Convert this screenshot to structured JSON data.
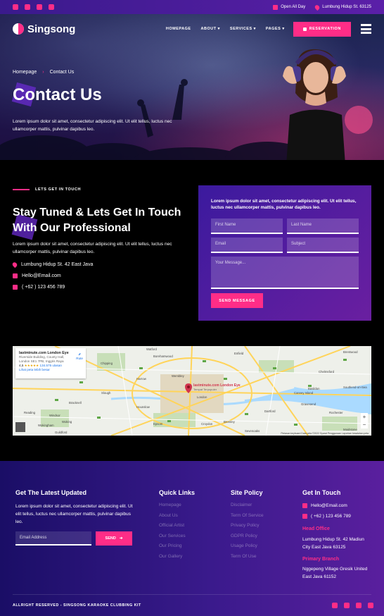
{
  "topbar": {
    "socials": [
      "facebook-icon",
      "twitter-icon",
      "youtube-icon",
      "linkedin-icon"
    ],
    "hours": "Open All Day",
    "address": "Lumbung Hidup St. 63125"
  },
  "nav": {
    "logo": "Singsong",
    "items": [
      "HOMEPAGE",
      "ABOUT",
      "SERVICES",
      "PAGES"
    ],
    "reservation": "RESERVATION"
  },
  "hero": {
    "breadcrumb": [
      "Homepage",
      "Contact Us"
    ],
    "title": "Contact Us",
    "text": "Lorem ipsum dolor sit amet, consectetur adipiscing elit. Ut elit tellus, luctus nec ullamcorper mattis, pulvinar dapibus leo."
  },
  "contact": {
    "eyebrow": "LETS GET IN TOUCH",
    "title": "Stay Tuned & Lets Get In Touch With Our Professional",
    "text": "Lorem ipsum dolor sit amet, consectetur adipiscing elit. Ut elit tellus, luctus nec ullamcorper mattis, pulvinar dapibus leo.",
    "address": "Lumbung Hidup St. 42 East Java",
    "email": "Hello@Email.com",
    "phone": "( +62 ) 123 456 789"
  },
  "form": {
    "intro": "Lorem ipsum dolor sit amet, consectetur adipiscing elit. Ut elit tellus, luctus nec ullamcorper mattis, pulvinar dapibus leo.",
    "first_name": "First Name",
    "last_name": "Last Name",
    "email": "Email",
    "subject": "Subject",
    "message": "Your Message...",
    "send": "SEND MESSAGE"
  },
  "map": {
    "place": "lastminute.com London Eye",
    "place_address": "Riverside Building, County Hall, London SE1 7PB, Inggris Raya",
    "rating": "4,5",
    "stars": "★★★★★",
    "reviews": "134.575 ulasan",
    "larger_map": "Lihat peta lebih besar",
    "route": "Rute",
    "pin_label": "lastminute.com London Eye",
    "pin_sub": "Tempat Terpopuler",
    "labels": [
      "Watford",
      "Borehamwood",
      "Enfield",
      "Brentwood",
      "Chipping",
      "Harrow",
      "Wembley",
      "Chelmsford",
      "Slough",
      "Woking",
      "Windsor",
      "Reading",
      "Hounslow",
      "London",
      "Croydon",
      "Epsom",
      "Bromley",
      "Dartford",
      "Gravesend",
      "Basildon",
      "Southend-on-Sea",
      "Canvey Island",
      "Sevenoaks",
      "Maidstone",
      "Rochester",
      "Guildford",
      "Bracknell",
      "Wokingham"
    ],
    "attribution": "Pintasan keyboard   Data peta ©2022   Syarat Penggunaan   Laporkan kesalahan peta"
  },
  "footer": {
    "newsletter_title": "Get The Latest Updated",
    "newsletter_text": "Lorem ipsum dolor sit amet, consectetur adipiscing elit. Ut elit tellus, luctus nec ullamcorper mattis, pulvinar dapibus leo.",
    "email_placeholder": "Email Address",
    "send": "SEND",
    "quick_links_title": "Quick Links",
    "quick_links": [
      "Homepage",
      "About Us",
      "Official Artist",
      "Our Services",
      "Our Pricing",
      "Our Gallery"
    ],
    "policy_title": "Site Policy",
    "policy_links": [
      "Disclaimer",
      "Term Of Service",
      "Privacy Policy",
      "GDPR Policy",
      "Usage Policy",
      "Term Of Use"
    ],
    "touch_title": "Get In Touch",
    "email": "Hello@Email.com",
    "phone": "( +62 ) 123 456 789",
    "head_office_title": "Head Office",
    "head_office": "Lumbung Hidup St. 42 Madiun City East Java 63125",
    "primary_branch_title": "Primary Branch",
    "primary_branch": "Nggepeng Village Gresik United East Java 61152",
    "copyright": "ALLRIGHT RESERVED - SINGSONG KARAOKE CLUBBING KIT"
  },
  "colors": {
    "accent": "#ff2d87",
    "purple": "#3b1a9e",
    "dark": "#000000"
  }
}
